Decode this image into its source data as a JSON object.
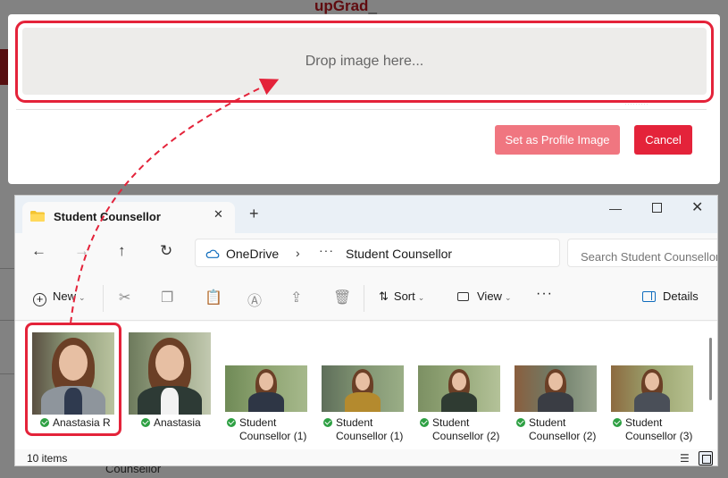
{
  "background": {
    "logo_text": "upGrad",
    "footer_text": "Counsellor"
  },
  "modal": {
    "drop_zone_text": "Drop image here...",
    "set_profile_button": "Set as Profile Image",
    "cancel_button": "Cancel"
  },
  "explorer": {
    "tab_title": "Student Counsellor",
    "tab_close": "✕",
    "new_tab": "+",
    "window_min": "—",
    "window_close": "✕",
    "nav": {
      "back": "←",
      "forward": "→",
      "up": "↑",
      "refresh": "↻"
    },
    "breadcrumb": {
      "root": "OneDrive",
      "separator": "›",
      "more": "···",
      "folder": "Student Counsellor"
    },
    "search_placeholder": "Search Student Counsellor",
    "toolbar": {
      "new": "New",
      "sort": "Sort",
      "view": "View",
      "more": "···",
      "details": "Details"
    },
    "files": [
      {
        "name": "Anastasia R",
        "selected": true
      },
      {
        "name": "Anastasia",
        "selected": false
      },
      {
        "name": "Student Counsellor (1)",
        "selected": false
      },
      {
        "name": "Student Counsellor (1)",
        "selected": false
      },
      {
        "name": "Student Counsellor (2)",
        "selected": false
      },
      {
        "name": "Student Counsellor (2)",
        "selected": false
      },
      {
        "name": "Student Counsellor (3)",
        "selected": false
      }
    ],
    "status": "10 items"
  },
  "colors": {
    "accent_red": "#e4233a",
    "sync_green": "#2ea043",
    "folder_yellow": "#f4c430",
    "onedrive_blue": "#0f6cbd"
  }
}
